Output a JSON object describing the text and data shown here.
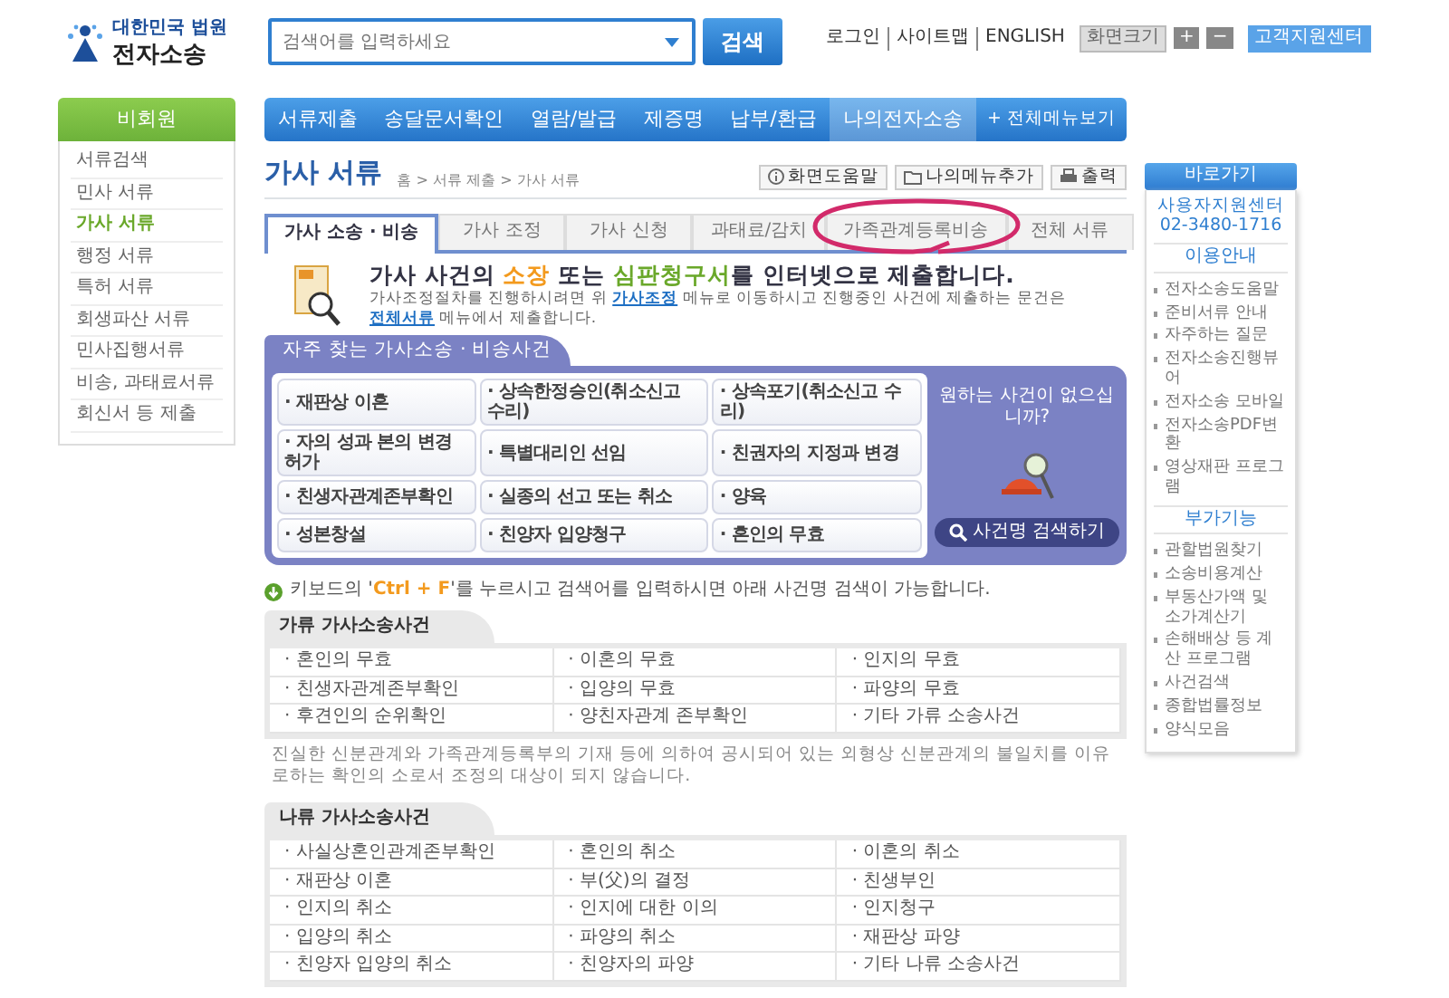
{
  "logo": {
    "line1": "대한민국 법원",
    "line2": "전자소송"
  },
  "search": {
    "placeholder": "검색어를 입력하세요",
    "button": "검색"
  },
  "utility_links": [
    "로그인",
    "사이트맵",
    "ENGLISH"
  ],
  "font_size": {
    "label": "화면크기",
    "buttons": [
      "+",
      "−"
    ]
  },
  "support_button": "고객지원센터",
  "nav": [
    {
      "label": "서류제출",
      "selected": false
    },
    {
      "label": "송달문서확인",
      "selected": false
    },
    {
      "label": "열람/발급",
      "selected": false
    },
    {
      "label": "제증명",
      "selected": false
    },
    {
      "label": "납부/환급",
      "selected": false
    },
    {
      "label": "나의전자소송",
      "selected": true
    }
  ],
  "nav_all": "+ 전체메뉴보기",
  "sidebar": {
    "title": "비회원",
    "items": [
      {
        "label": "서류검색",
        "selected": false
      },
      {
        "label": "민사 서류",
        "selected": false
      },
      {
        "label": "가사 서류",
        "selected": true
      },
      {
        "label": "행정 서류",
        "selected": false
      },
      {
        "label": "특허 서류",
        "selected": false
      },
      {
        "label": "회생파산 서류",
        "selected": false
      },
      {
        "label": "민사집행서류",
        "selected": false
      },
      {
        "label": "비송, 과태료서류",
        "selected": false
      },
      {
        "label": "회신서 등 제출",
        "selected": false
      }
    ]
  },
  "page": {
    "title": "가사 서류",
    "breadcrumb": "홈 > 서류 제출 > 가사 서류",
    "actions": [
      {
        "kind": "help",
        "label": "화면도움말"
      },
      {
        "kind": "bookmark",
        "label": "나의메뉴추가"
      },
      {
        "kind": "print",
        "label": "출력"
      }
    ]
  },
  "tabs": [
    {
      "label": "가사 소송 · 비송",
      "selected": true
    },
    {
      "label": "가사 조정",
      "selected": false
    },
    {
      "label": "가사 신청",
      "selected": false
    },
    {
      "label": "과태료/감치",
      "selected": false
    },
    {
      "label": "가족관계등록비송",
      "selected": false
    },
    {
      "label": "전체 서류",
      "selected": false
    }
  ],
  "intro": {
    "headline": [
      {
        "kind": "plain",
        "text": "가사 사건의 "
      },
      {
        "kind": "accent",
        "text": "소장"
      },
      {
        "kind": "plain",
        "text": " 또는 "
      },
      {
        "kind": "accent2",
        "text": "심판청구서"
      },
      {
        "kind": "plain",
        "text": "를 인터넷으로 제출합니다."
      }
    ],
    "note": [
      {
        "kind": "plain",
        "text": "가사조정절차를 진행하시려면 위 "
      },
      {
        "kind": "link",
        "text": "가사조정"
      },
      {
        "kind": "plain",
        "text": " 메뉴로 이동하시고 진행중인 사건에 제출하는 문건은 "
      },
      {
        "kind": "link",
        "text": "전체서류"
      },
      {
        "kind": "plain",
        "text": " 메뉴에서 제출합니다."
      }
    ]
  },
  "frequent": {
    "title": "자주 찾는 가사소송 · 비송사건",
    "items": [
      "· 재판상 이혼",
      "· 상속한정승인(취소신고 수리)",
      "· 상속포기(취소신고 수리)",
      "· 자의 성과 본의 변경허가",
      "· 특별대리인 선임",
      "· 친권자의 지정과 변경",
      "· 친생자관계존부확인",
      "· 실종의 선고 또는 취소",
      "· 양육",
      "· 성본창설",
      "· 친양자 입양청구",
      "· 혼인의 무효"
    ],
    "prompt": "원하는 사건이 없으십니까?",
    "button": "사건명 검색하기"
  },
  "tip": [
    {
      "kind": "plain",
      "text": "키보드의 '"
    },
    {
      "kind": "key",
      "text": "Ctrl + F"
    },
    {
      "kind": "plain",
      "text": "'를 누르시고 검색어를 입력하시면 아래 사건명 검색이 가능합니다."
    }
  ],
  "tables": [
    {
      "title": "가류 가사소송사건",
      "cells": [
        "· 혼인의 무효",
        "· 이혼의 무효",
        "· 인지의 무효",
        "· 친생자관계존부확인",
        "· 입양의 무효",
        "· 파양의 무효",
        "· 후견인의 순위확인",
        "· 양친자관계 존부확인",
        "· 기타 가류 소송사건"
      ],
      "note": "진실한 신분관계와 가족관계등록부의 기재 등에 의하여 공시되어 있는 외형상 신분관계의 불일치를 이유로하는 확인의 소로서 조정의 대상이 되지 않습니다."
    },
    {
      "title": "나류 가사소송사건",
      "cells": [
        "· 사실상혼인관계존부확인",
        "· 혼인의 취소",
        "· 이혼의 취소",
        "· 재판상 이혼",
        "· 부(父)의 결정",
        "· 친생부인",
        "· 인지의 취소",
        "· 인지에 대한 이의",
        "· 인지청구",
        "· 입양의 취소",
        "· 파양의 취소",
        "· 재판상 파양",
        "· 친양자 입양의 취소",
        "· 친양자의 파양",
        "· 기타 나류 소송사건"
      ]
    }
  ],
  "quick": {
    "title": "바로가기",
    "contact": [
      "사용자지원센터",
      "02-3480-1716"
    ],
    "sections": [
      {
        "title": "이용안내",
        "items": [
          "전자소송도움말",
          "준비서류 안내",
          "자주하는 질문",
          "전자소송진행뷰어",
          "전자소송 모바일",
          "전자소송PDF변환",
          "영상재판 프로그램"
        ]
      },
      {
        "title": "부가기능",
        "items": [
          "관할법원찾기",
          "소송비용계산",
          "부동산가액 및 소가계산기",
          "손해배상 등 계산 프로그램",
          "사건검색",
          "종합법률정보",
          "양식모음"
        ]
      }
    ]
  }
}
